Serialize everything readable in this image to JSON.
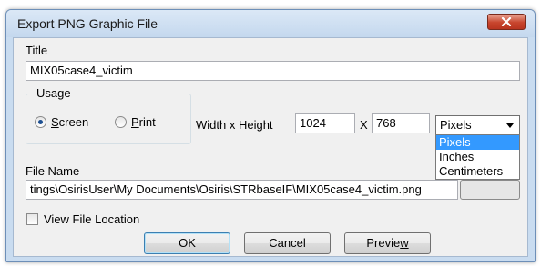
{
  "window": {
    "title": "Export PNG Graphic File"
  },
  "title_field": {
    "label": "Title",
    "value": "MIX05case4_victim"
  },
  "usage": {
    "label": "Usage",
    "options": [
      {
        "label_prefix": "",
        "mnemonic": "S",
        "label_rest": "creen",
        "selected": true
      },
      {
        "label_prefix": "",
        "mnemonic": "P",
        "label_rest": "rint",
        "selected": false
      }
    ]
  },
  "dimensions": {
    "label": "Width x Height",
    "width": "1024",
    "separator": "X",
    "height": "768",
    "unit_selected": "Pixels",
    "unit_options": [
      "Pixels",
      "Inches",
      "Centimeters"
    ]
  },
  "file_name": {
    "label": "File Name",
    "value": "tings\\OsirisUser\\My Documents\\Osiris\\STRbaseIF\\MIX05case4_victim.png"
  },
  "view_location": {
    "label": "View File Location",
    "checked": false
  },
  "buttons": {
    "ok": "OK",
    "cancel": "Cancel",
    "preview_prefix": "Previe",
    "preview_mnemonic": "w"
  },
  "icons": {
    "close": "close-x-icon",
    "dropdown": "chevron-down-icon"
  },
  "colors": {
    "titlebar": "#c4d8ee",
    "close_button": "#c8452d",
    "selection": "#3399ff"
  }
}
